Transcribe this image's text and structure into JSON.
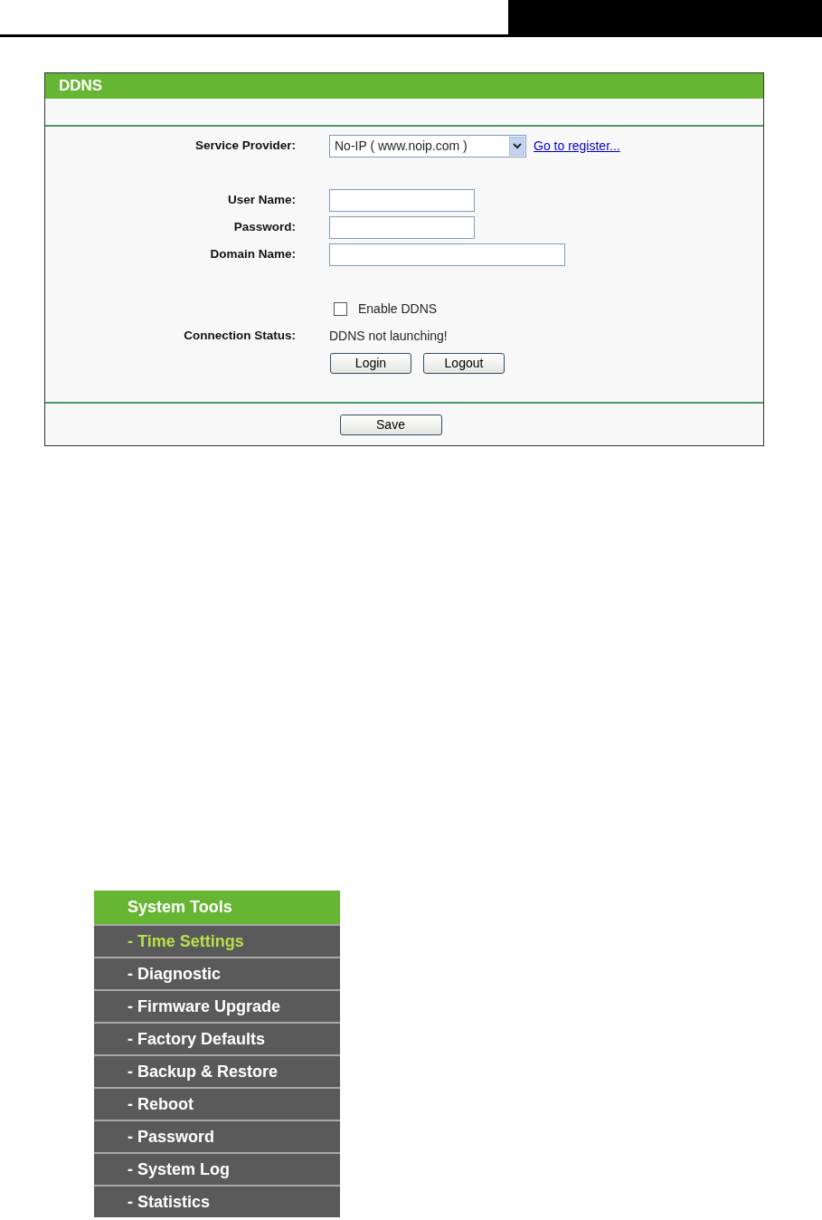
{
  "panel": {
    "title": "DDNS",
    "fields": [
      {
        "kind": "select",
        "label": "Service Provider:",
        "value": "No-IP ( www.noip.com )",
        "link": "Go to register..."
      },
      {
        "kind": "blank"
      },
      {
        "kind": "text",
        "label": "User Name:",
        "wide": false
      },
      {
        "kind": "password",
        "label": "Password:",
        "wide": false
      },
      {
        "kind": "text",
        "label": "Domain Name:",
        "wide": true
      },
      {
        "kind": "blank"
      },
      {
        "kind": "checkbox",
        "label": "Enable DDNS",
        "checked": false
      },
      {
        "kind": "status",
        "label": "Connection Status:",
        "value": "DDNS not launching!"
      },
      {
        "kind": "buttons",
        "buttons": [
          "Login",
          "Logout"
        ]
      }
    ],
    "save": "Save"
  },
  "menu": {
    "title": "System Tools",
    "items": [
      {
        "label": "- Time Settings",
        "selected": true
      },
      {
        "label": "- Diagnostic",
        "selected": false
      },
      {
        "label": "- Firmware Upgrade",
        "selected": false
      },
      {
        "label": "- Factory Defaults",
        "selected": false
      },
      {
        "label": "- Backup & Restore",
        "selected": false
      },
      {
        "label": "- Reboot",
        "selected": false
      },
      {
        "label": "- Password",
        "selected": false
      },
      {
        "label": "- System Log",
        "selected": false
      },
      {
        "label": "- Statistics",
        "selected": false
      }
    ]
  }
}
